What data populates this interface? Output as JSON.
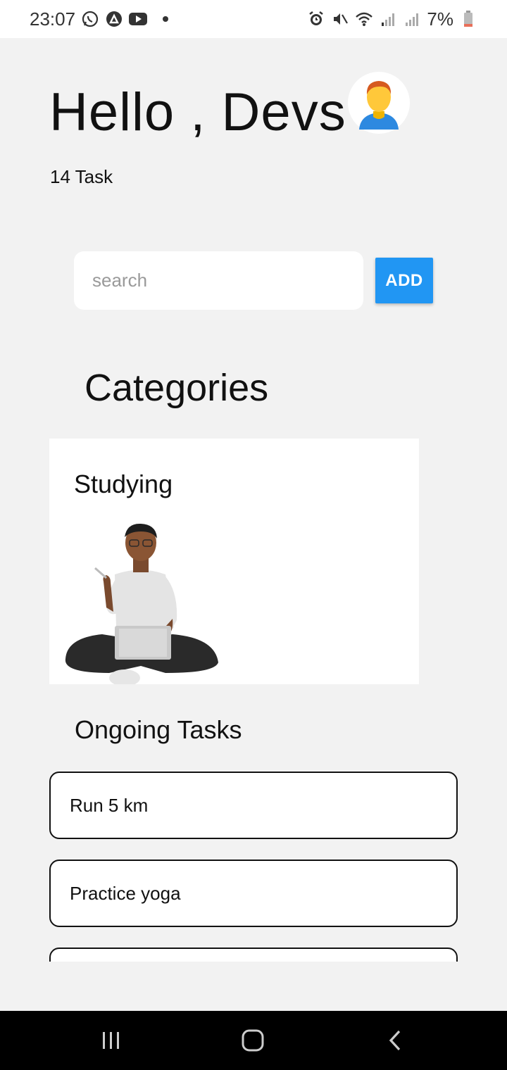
{
  "status_bar": {
    "time": "23:07",
    "left_icons": [
      "whatsapp-icon",
      "nearby-share-icon",
      "youtube-icon",
      "notification-dot"
    ],
    "right_icons": [
      "alarm-icon",
      "mute-icon",
      "wifi-icon",
      "signal-icon",
      "signal-icon"
    ],
    "battery": "7%"
  },
  "header": {
    "greeting": "Hello , Devs",
    "avatar_icon": "man-avatar-icon",
    "task_count": "14 Task"
  },
  "search": {
    "placeholder": "search",
    "value": ""
  },
  "add_button": {
    "label": "ADD",
    "color": "#2196f3"
  },
  "categories": {
    "title": "Categories",
    "items": [
      {
        "label": "Studying",
        "image": "person-with-laptop-illustration"
      }
    ]
  },
  "ongoing": {
    "title": "Ongoing Tasks",
    "tasks": [
      {
        "label": "Run 5 km"
      },
      {
        "label": "Practice yoga"
      },
      {
        "label": ""
      }
    ]
  },
  "nav_bar": {
    "buttons": [
      "recent-apps-icon",
      "home-icon",
      "back-icon"
    ]
  }
}
